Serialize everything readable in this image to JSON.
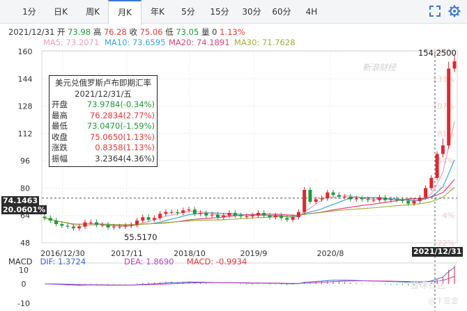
{
  "tabs": [
    {
      "label": "1分"
    },
    {
      "label": "日K"
    },
    {
      "label": "周K"
    },
    {
      "label": "月K"
    },
    {
      "label": "年K"
    },
    {
      "label": "5分"
    },
    {
      "label": "15分"
    },
    {
      "label": "30分"
    },
    {
      "label": "60分"
    },
    {
      "label": "4H"
    }
  ],
  "active_tab": "月K",
  "toolbar_icons": [
    "fullscreen-icon",
    "settings-icon"
  ],
  "info": {
    "date": "2021/12/31",
    "open_label": "开",
    "open": "73.98",
    "high_label": "高",
    "high": "76.28",
    "close_label": "收",
    "close": "75.06",
    "low_label": "低",
    "low": "73.05",
    "vol_label": "量",
    "vol": "0",
    "change": "1.13%"
  },
  "ma": [
    {
      "label": "MA5: 73.2071",
      "color": "#f0a0b8"
    },
    {
      "label": "MA10: 73.6595",
      "color": "#3aa6d8"
    },
    {
      "label": "MA20: 74.1891",
      "color": "#e0407a"
    },
    {
      "label": "MA30: 71.7628",
      "color": "#9bb23a"
    }
  ],
  "y_axis_left": [
    "160",
    "144",
    "128",
    "112",
    "96",
    "80",
    "64",
    "48"
  ],
  "y_axis_right": [
    "154%",
    "133%",
    "107%",
    "81%",
    "54%",
    "28%",
    "4%",
    "-22%"
  ],
  "x_axis": [
    "2016/12/30",
    "2017/11",
    "2018/10",
    "2019/9",
    "2020/8"
  ],
  "crosshair": {
    "price": "74.1463",
    "pct": "20.0601%",
    "date": "2021/12/31"
  },
  "max_label": "154.2500",
  "min_label": "55.5170",
  "tooltip": {
    "title": "美元兑俄罗斯卢布即期汇率",
    "date": "2021/12/31/五",
    "rows": [
      {
        "k": "开盘",
        "v": "73.9784(-0.34%)",
        "tone": "green"
      },
      {
        "k": "最高",
        "v": "76.2834(2.77%)",
        "tone": "red"
      },
      {
        "k": "最低",
        "v": "73.0470(-1.59%)",
        "tone": "green"
      },
      {
        "k": "收盘",
        "v": "75.0650(1.13%)",
        "tone": "red"
      },
      {
        "k": "涨跌",
        "v": "0.8358(1.13%)",
        "tone": "red"
      },
      {
        "k": "振幅",
        "v": "3.2364(4.36%)",
        "tone": "black"
      }
    ]
  },
  "macd": {
    "title": "MACD",
    "dif": "DIF: 1.3724",
    "dea": "DEA: 1.8690",
    "macd": "MACD: -0.9934",
    "axis": [
      "10",
      "0",
      "-10"
    ]
  },
  "watermarks": {
    "sina": "新浪财经",
    "bottom1": "雪球社区",
    "bottom2": "@卞亚金"
  },
  "chart_data": {
    "type": "candlestick",
    "title": "美元兑俄罗斯卢布即期汇率",
    "ylim": [
      48,
      160
    ],
    "x_ticks": [
      "2016/12/30",
      "2017/11",
      "2018/10",
      "2019/9",
      "2020/8",
      "2021/12/31"
    ],
    "candles_close": [
      62.5,
      61,
      59,
      58,
      57.5,
      56.5,
      57.5,
      60,
      60,
      58.5,
      58.5,
      57,
      57.5,
      57.5,
      58,
      58.5,
      61,
      63,
      61.5,
      62.5,
      65,
      66,
      66,
      65.5,
      67,
      67.5,
      65,
      65.5,
      64,
      64.5,
      63,
      64,
      65.5,
      64,
      63.5,
      63.5,
      64,
      65.5,
      64,
      63,
      64,
      62.5,
      61.5,
      63,
      66,
      79,
      72,
      73.5,
      74,
      77.5,
      76,
      75,
      75,
      73.5,
      74,
      73.5,
      73,
      73,
      74.5,
      73,
      73.5,
      73,
      72.5,
      71,
      72.5,
      74.5,
      80,
      86,
      100,
      105,
      150,
      154.25
    ],
    "series_current_values": {
      "MA5": 73.2071,
      "MA10": 73.6595,
      "MA20": 74.1891,
      "MA30": 71.7628
    },
    "macd_current": {
      "DIF": 1.3724,
      "DEA": 1.869,
      "MACD": -0.9934
    }
  }
}
